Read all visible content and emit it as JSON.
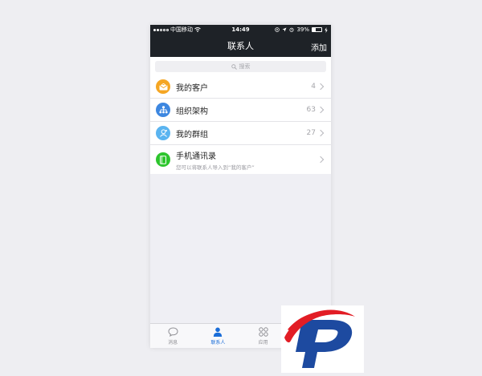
{
  "statusbar": {
    "carrier": "中国移动",
    "time": "14:49",
    "battery": "39%",
    "battery_level": 0.39
  },
  "navbar": {
    "title": "联系人",
    "add_label": "添加"
  },
  "search": {
    "placeholder": "搜索"
  },
  "list": [
    {
      "label": "我的客户",
      "count": "4",
      "icon": "customer-envelope-icon",
      "color": "#f5a623"
    },
    {
      "label": "组织架构",
      "count": "63",
      "icon": "org-structure-icon",
      "color": "#3d87e0"
    },
    {
      "label": "我的群组",
      "count": "27",
      "icon": "group-icon",
      "color": "#5ab4f0"
    },
    {
      "label": "手机通讯录",
      "sub": "您可以将联系人导入到“我的客户”",
      "icon": "phonebook-icon",
      "color": "#2dc52d"
    }
  ],
  "tabbar": {
    "tabs": [
      {
        "label": "消息",
        "icon": "chat-bubble-icon",
        "active": false
      },
      {
        "label": "联系人",
        "icon": "person-icon",
        "active": true
      },
      {
        "label": "应用",
        "icon": "apps-grid-icon",
        "active": false
      }
    ]
  },
  "colors": {
    "navbar": "#1e2227",
    "accent": "#1a6dd8",
    "logo_red": "#e21d25",
    "logo_blue": "#1d4aa0"
  }
}
